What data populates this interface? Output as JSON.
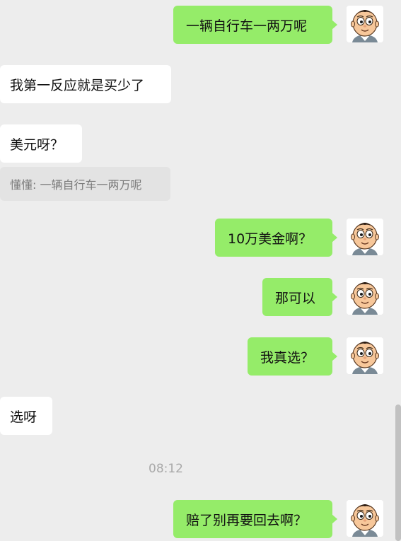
{
  "messages": [
    {
      "side": "me",
      "text": "一辆自行车一两万呢"
    },
    {
      "side": "other",
      "text": "我第一反应就是买少了"
    },
    {
      "side": "other",
      "text": "美元呀？"
    },
    {
      "side": "quote",
      "text": "懂懂: 一辆自行车一两万呢"
    },
    {
      "side": "me",
      "text": "10万美金啊？"
    },
    {
      "side": "me",
      "text": "那可以"
    },
    {
      "side": "me",
      "text": "我真选？"
    },
    {
      "side": "other",
      "text": "选呀"
    },
    {
      "side": "me",
      "text": "赔了别再要回去啊？"
    }
  ],
  "timestamp": "08:12",
  "avatar_icon": "cartoon-boy-avatar-icon",
  "colors": {
    "background": "#ededed",
    "my_bubble": "#95ec69",
    "their_bubble": "#ffffff",
    "quote_bg": "#e3e3e3"
  }
}
